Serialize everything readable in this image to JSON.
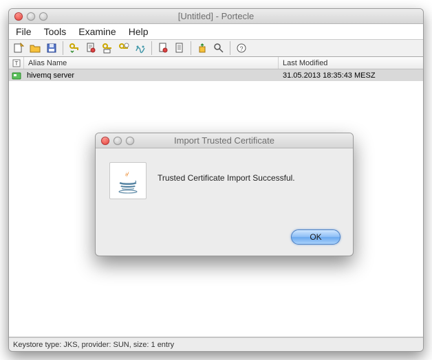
{
  "window": {
    "title": "[Untitled] - Portecle"
  },
  "menu": {
    "file": "File",
    "tools": "Tools",
    "examine": "Examine",
    "help": "Help"
  },
  "table": {
    "headers": {
      "alias": "Alias Name",
      "modified": "Last Modified"
    },
    "rows": [
      {
        "alias": "hivemq server",
        "modified": "31.05.2013 18:35:43 MESZ"
      }
    ]
  },
  "status": {
    "text": "Keystore type: JKS, provider: SUN, size: 1 entry"
  },
  "dialog": {
    "title": "Import Trusted Certificate",
    "message": "Trusted Certificate Import Successful.",
    "ok": "OK"
  }
}
